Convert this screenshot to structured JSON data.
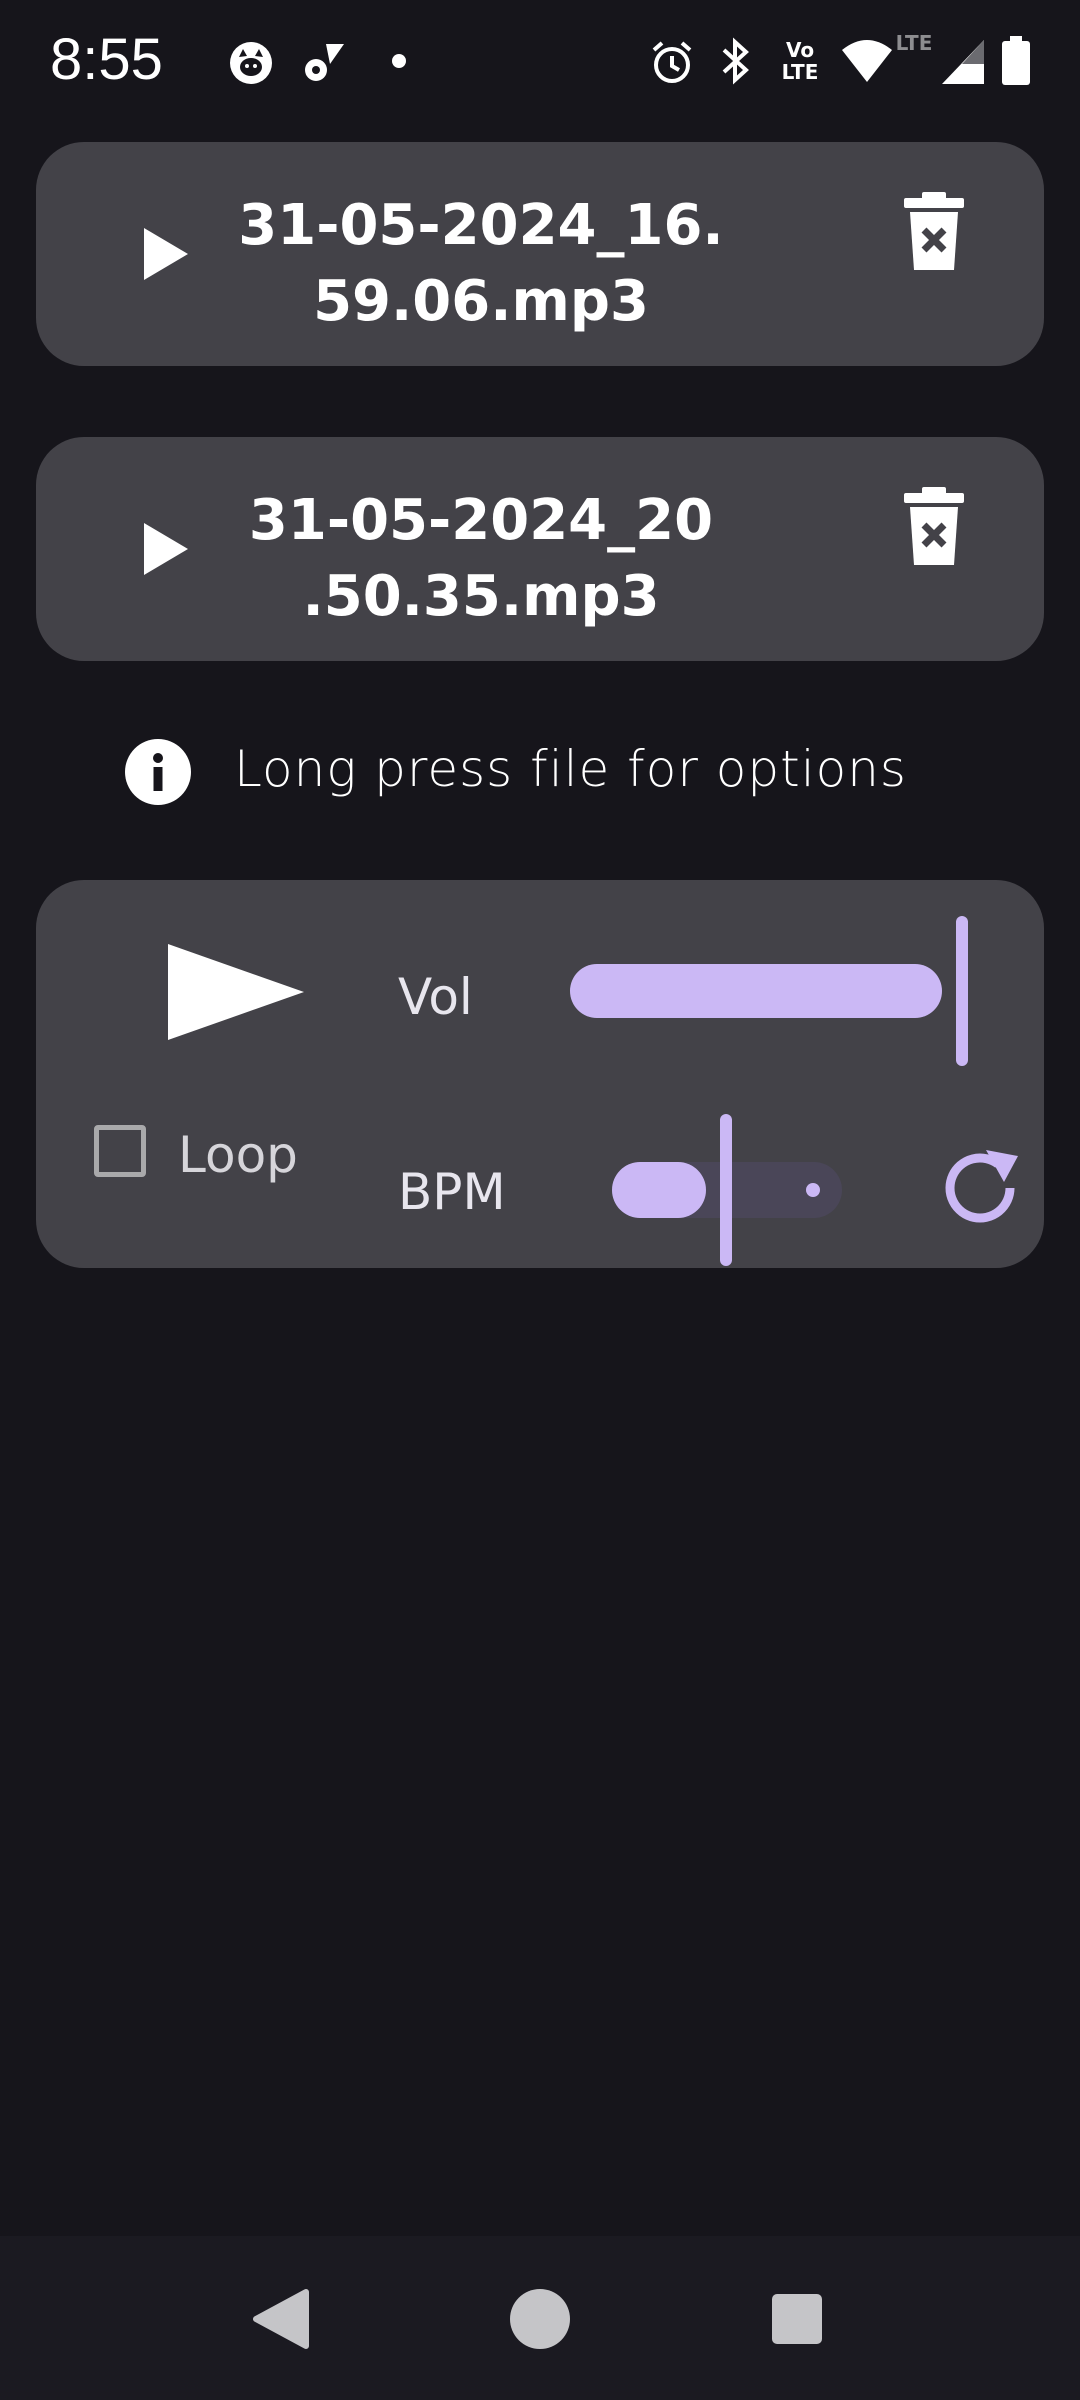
{
  "status": {
    "time": "8:55",
    "icons": [
      "cat-icon",
      "settings-wifi-icon",
      "dot-icon",
      "alarm-icon",
      "bluetooth-icon",
      "volte-icon",
      "wifi-icon",
      "lte-signal-icon",
      "battery-icon"
    ],
    "volte_label_top": "Vo",
    "volte_label_bottom": "LTE",
    "lte_label": "LTE"
  },
  "files": [
    {
      "line1": "31-05-2024_16.",
      "line2": "59.06.mp3"
    },
    {
      "line1": "31-05-2024_20",
      "line2": ".50.35.mp3"
    }
  ],
  "hint": {
    "text": "Long press file for options"
  },
  "player": {
    "vol_label": "Vol",
    "bpm_label": "BPM",
    "loop_label": "Loop",
    "loop_checked": false,
    "vol_level": 1.0,
    "bpm_level": 0.5
  },
  "colors": {
    "background": "#16151b",
    "card": "#434248",
    "accent": "#cbb8f5",
    "track_inactive": "#4a4658"
  }
}
